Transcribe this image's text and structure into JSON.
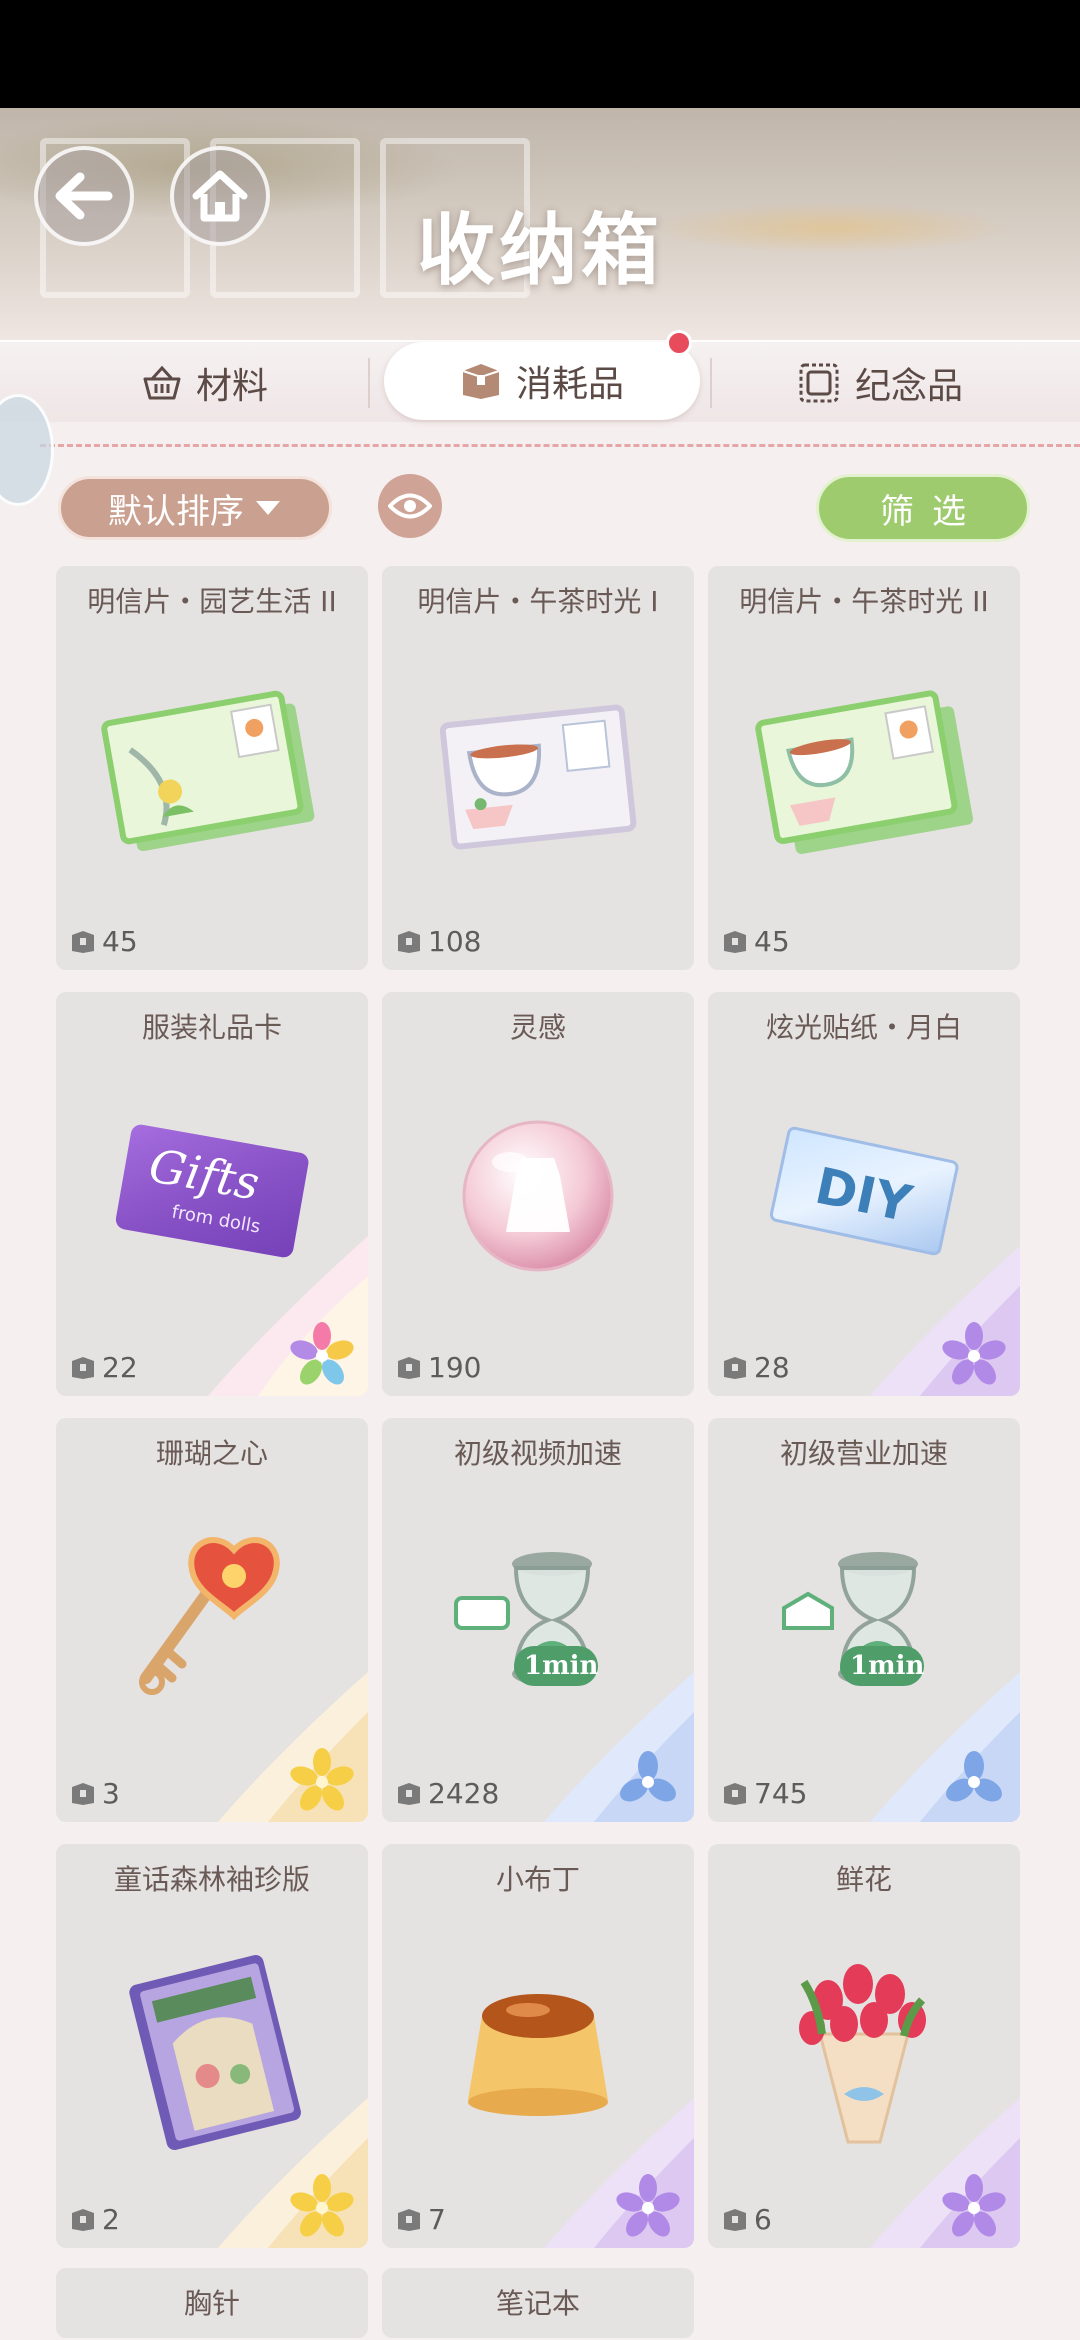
{
  "header": {
    "title": "收纳箱"
  },
  "tabs": [
    {
      "label": "材料",
      "icon": "basket-icon",
      "active": false
    },
    {
      "label": "消耗品",
      "icon": "box-icon",
      "active": true,
      "notification": true
    },
    {
      "label": "纪念品",
      "icon": "stamp-icon",
      "active": false
    }
  ],
  "toolbar": {
    "sort_label": "默认排序",
    "filter_label": "筛选"
  },
  "colors": {
    "accent_sort": "#caa190",
    "accent_filter": "#9fcb6f",
    "notify": "#e84b5c"
  },
  "items": [
    {
      "name": "明信片・园艺生活 II",
      "count": "45",
      "rarity": "none",
      "icon": "postcard-garden-icon"
    },
    {
      "name": "明信片・午茶时光 I",
      "count": "108",
      "rarity": "none",
      "icon": "postcard-tea-icon"
    },
    {
      "name": "明信片・午茶时光 II",
      "count": "45",
      "rarity": "none",
      "icon": "postcard-tea-stack-icon"
    },
    {
      "name": "服装礼品卡",
      "count": "22",
      "rarity": "rainbow",
      "icon": "gift-card-icon"
    },
    {
      "name": "灵感",
      "count": "190",
      "rarity": "none",
      "icon": "inspiration-orb-icon"
    },
    {
      "name": "炫光贴纸・月白",
      "count": "28",
      "rarity": "purple",
      "icon": "diy-sticker-icon"
    },
    {
      "name": "珊瑚之心",
      "count": "3",
      "rarity": "gold",
      "icon": "heart-key-icon"
    },
    {
      "name": "初级视频加速",
      "count": "2428",
      "rarity": "blue",
      "icon": "hourglass-video-icon",
      "badge": "1min"
    },
    {
      "name": "初级营业加速",
      "count": "745",
      "rarity": "blue",
      "icon": "hourglass-shop-icon",
      "badge": "1min"
    },
    {
      "name": "童话森林袖珍版",
      "count": "2",
      "rarity": "gold",
      "icon": "storybook-icon"
    },
    {
      "name": "小布丁",
      "count": "7",
      "rarity": "purple",
      "icon": "pudding-icon"
    },
    {
      "name": "鲜花",
      "count": "6",
      "rarity": "purple",
      "icon": "tulip-bouquet-icon"
    },
    {
      "name": "胸针",
      "count": "",
      "rarity": "none",
      "icon": "brooch-icon"
    },
    {
      "name": "笔记本",
      "count": "",
      "rarity": "none",
      "icon": "notebook-icon"
    }
  ]
}
